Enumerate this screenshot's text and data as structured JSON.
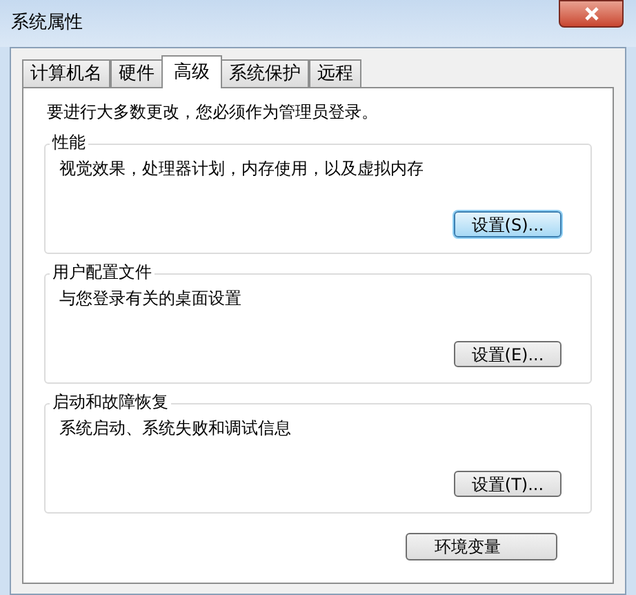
{
  "window": {
    "title": "系统属性"
  },
  "tabs": [
    {
      "label": "计算机名",
      "selected": false
    },
    {
      "label": "硬件",
      "selected": false
    },
    {
      "label": "高级",
      "selected": true
    },
    {
      "label": "系统保护",
      "selected": false
    },
    {
      "label": "远程",
      "selected": false
    }
  ],
  "notice": "要进行大多数更改，您必须作为管理员登录。",
  "groups": [
    {
      "title": "性能",
      "description": "视觉效果，处理器计划，内存使用，以及虚拟内存",
      "button": {
        "label": "设置(S)...",
        "focused": true
      }
    },
    {
      "title": "用户配置文件",
      "description": "与您登录有关的桌面设置",
      "button": {
        "label": "设置(E)...",
        "focused": false
      }
    },
    {
      "title": "启动和故障恢复",
      "description": "系统启动、系统失败和调试信息",
      "button": {
        "label": "设置(T)...",
        "focused": false
      }
    }
  ],
  "footer_button": "环境变量"
}
